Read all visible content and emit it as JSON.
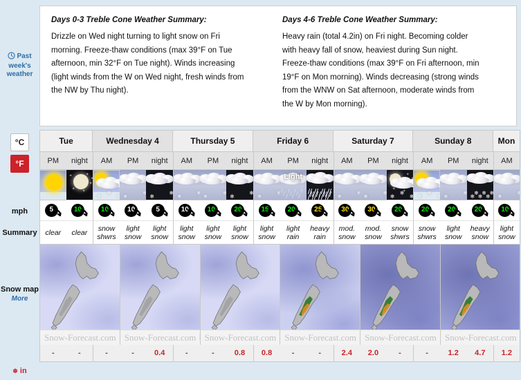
{
  "rail": {
    "past_week_line1": "Past",
    "past_week_line2": "week's",
    "past_week_line3": "weather",
    "unit_c": "°C",
    "unit_f": "°F",
    "mph_label": "mph",
    "summary_label": "Summary",
    "snowmap_label": "Snow map",
    "snowmap_more": "More",
    "snow_unit_label": "in"
  },
  "summary": {
    "left_title": "Days 0-3 Treble Cone Weather Summary:",
    "left_body": "Drizzle on Wed night turning to light snow on Fri morning. Freeze-thaw conditions (max 39°F on Tue afternoon, min 32°F on Tue night). Winds increasing (light winds from the W on Wed night, fresh winds from the NW by Thu night).",
    "right_title": "Days 4-6 Treble Cone Weather Summary:",
    "right_body": "Heavy rain (total 4.2in) on Fri night. Becoming colder with heavy fall of snow, heaviest during Sun night. Freeze-thaw conditions (max 39°F on Fri afternoon, min 19°F on Mon morning). Winds decreasing (strong winds from the WNW on Sat afternoon, moderate winds from the W by Mon morning)."
  },
  "days": [
    {
      "label": "Tue",
      "slots": 2
    },
    {
      "label": "Wednesday 4",
      "slots": 3
    },
    {
      "label": "Thursday 5",
      "slots": 3
    },
    {
      "label": "Friday 6",
      "slots": 3
    },
    {
      "label": "Saturday 7",
      "slots": 3
    },
    {
      "label": "Sunday 8",
      "slots": 3
    },
    {
      "label": "Mon",
      "slots": 1
    }
  ],
  "columns": [
    {
      "time": "PM",
      "day_index": 0,
      "icon": "sun",
      "wind": "5",
      "wind_color": "#ffffff",
      "summary": "clear",
      "snow": "-"
    },
    {
      "time": "night",
      "day_index": 0,
      "icon": "moon",
      "wind": "10",
      "wind_color": "#00ee00",
      "summary": "clear",
      "snow": "-"
    },
    {
      "time": "AM",
      "day_index": 1,
      "icon": "sun-cloud-snow",
      "wind": "10",
      "wind_color": "#00ee00",
      "summary": "snow shwrs",
      "snow": "-"
    },
    {
      "time": "PM",
      "day_index": 1,
      "icon": "cloud-snow",
      "wind": "10",
      "wind_color": "#ffffff",
      "summary": "light snow",
      "snow": "-"
    },
    {
      "time": "night",
      "day_index": 1,
      "icon": "cloud-snow-night",
      "wind": "5",
      "wind_color": "#ffffff",
      "summary": "light snow",
      "snow": "0.4"
    },
    {
      "time": "AM",
      "day_index": 2,
      "icon": "cloud-snow",
      "wind": "10",
      "wind_color": "#ffffff",
      "summary": "light snow",
      "snow": "-"
    },
    {
      "time": "PM",
      "day_index": 2,
      "icon": "cloud-snow",
      "wind": "10",
      "wind_color": "#00ee00",
      "summary": "light snow",
      "snow": "-"
    },
    {
      "time": "night",
      "day_index": 2,
      "icon": "cloud-snow-night",
      "wind": "20",
      "wind_color": "#00ee00",
      "summary": "light snow",
      "snow": "0.8"
    },
    {
      "time": "AM",
      "day_index": 3,
      "icon": "cloud-snow",
      "wind": "15",
      "wind_color": "#00ee00",
      "summary": "light snow",
      "snow": "0.8"
    },
    {
      "time": "PM",
      "day_index": 3,
      "icon": "cloud-rain-light",
      "wind": "20",
      "wind_color": "#00ee00",
      "summary": "light rain",
      "snow": "-"
    },
    {
      "time": "night",
      "day_index": 3,
      "icon": "cloud-rain-heavy",
      "wind": "25",
      "wind_color": "#ffe400",
      "summary": "heavy rain",
      "snow": "-"
    },
    {
      "time": "AM",
      "day_index": 4,
      "icon": "cloud-snow",
      "wind": "30",
      "wind_color": "#ffe400",
      "summary": "mod. snow",
      "snow": "2.4"
    },
    {
      "time": "PM",
      "day_index": 4,
      "icon": "cloud-snow",
      "wind": "30",
      "wind_color": "#ffe400",
      "summary": "mod. snow",
      "snow": "2.0"
    },
    {
      "time": "night",
      "day_index": 4,
      "icon": "moon-cloud-snow",
      "wind": "20",
      "wind_color": "#00ee00",
      "summary": "snow shwrs",
      "snow": "-"
    },
    {
      "time": "AM",
      "day_index": 5,
      "icon": "sun-cloud-snow",
      "wind": "20",
      "wind_color": "#00ee00",
      "summary": "snow shwrs",
      "snow": "-"
    },
    {
      "time": "PM",
      "day_index": 5,
      "icon": "cloud-snow",
      "wind": "20",
      "wind_color": "#00ee00",
      "summary": "light snow",
      "snow": "1.2"
    },
    {
      "time": "night",
      "day_index": 5,
      "icon": "cloud-snow-heavy-night",
      "wind": "20",
      "wind_color": "#00ee00",
      "summary": "heavy snow",
      "snow": "4.7"
    },
    {
      "time": "AM",
      "day_index": 6,
      "icon": "cloud-snow",
      "wind": "10",
      "wind_color": "#00ee00",
      "summary": "light snow",
      "snow": "1.2"
    }
  ],
  "icon_overlay": {
    "light_label": "Light"
  },
  "maps": [
    {
      "tone": "lite"
    },
    {
      "tone": "lite"
    },
    {
      "tone": "lite"
    },
    {
      "tone": "mid"
    },
    {
      "tone": "dark"
    },
    {
      "tone": "dark"
    }
  ],
  "map_footer": {
    "brand": "Snow-Forecast.com"
  },
  "colors": {
    "accent_red": "#cc2229",
    "link_blue": "#2e6da4",
    "wind_green": "#00ee00",
    "wind_yellow": "#ffe400",
    "page_bg": "#dce9f2"
  }
}
